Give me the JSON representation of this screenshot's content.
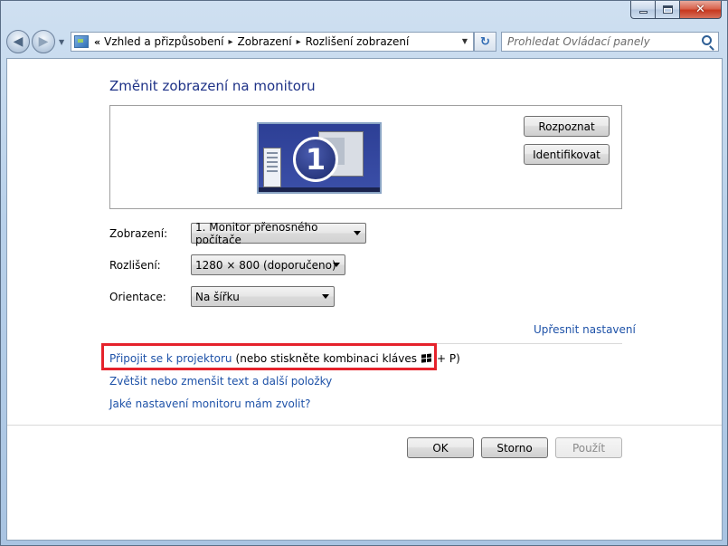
{
  "window": {
    "caption_buttons": {
      "minimize_icon": "minimize-icon",
      "maximize_icon": "maximize-icon",
      "close_icon": "close-icon"
    }
  },
  "nav": {
    "back_glyph": "◀",
    "forward_glyph": "▶",
    "overflow_glyph": "«",
    "breadcrumbs": [
      "Vzhled a přizpůsobení",
      "Zobrazení",
      "Rozlišení zobrazení"
    ],
    "separator_glyph": "▸",
    "refresh_glyph": "↻",
    "search_placeholder": "Prohledat Ovládací panely"
  },
  "main": {
    "heading": "Změnit zobrazení na monitoru",
    "monitor_number": "1",
    "detect_button": "Rozpoznat",
    "identify_button": "Identifikovat",
    "display_label": "Zobrazení:",
    "display_value": "1. Monitor přenosného počítače",
    "resolution_label": "Rozlišení:",
    "resolution_value": "1280 × 800 (doporučeno)",
    "orientation_label": "Orientace:",
    "orientation_value": "Na šířku",
    "advanced_link": "Upřesnit nastavení",
    "projector_link": "Připojit se k projektoru",
    "projector_hint_prefix": "(nebo stiskněte kombinaci kláves",
    "projector_hint_suffix": "+ P)",
    "text_size_link": "Zvětšit nebo zmenšit text a další položky",
    "help_link": "Jaké nastavení monitoru mám zvolit?"
  },
  "footer": {
    "ok": "OK",
    "cancel": "Storno",
    "apply": "Použít"
  },
  "colors": {
    "link": "#1e52a8",
    "heading": "#1e3287",
    "highlight": "#e5222b"
  }
}
